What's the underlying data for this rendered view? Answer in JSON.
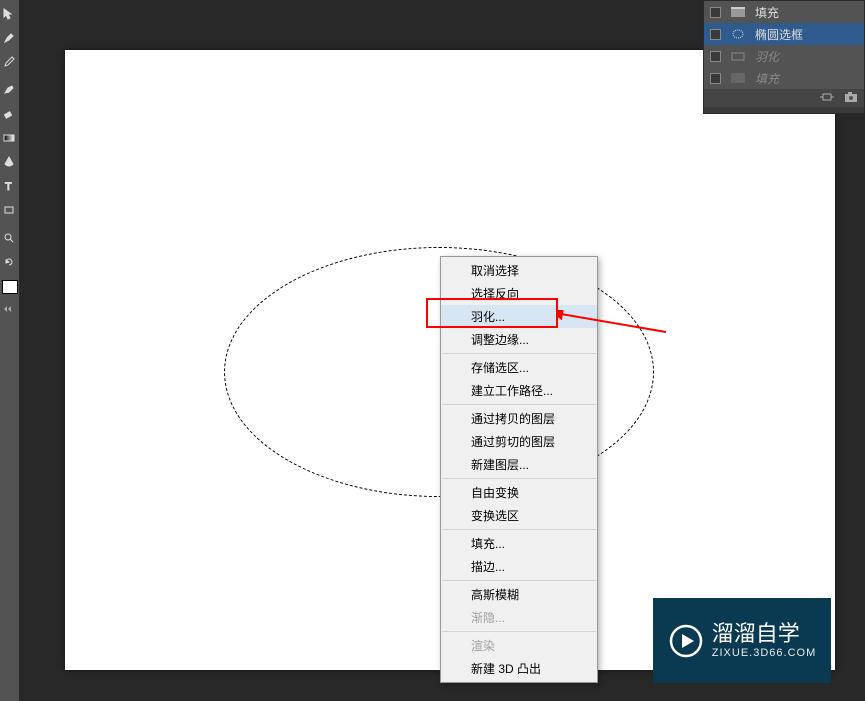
{
  "contextMenu": {
    "deselect": "取消选择",
    "selectInverse": "选择反向",
    "feather": "羽化...",
    "refineEdge": "调整边缘...",
    "saveSelection": "存储选区...",
    "makeWorkPath": "建立工作路径...",
    "layerViaCopy": "通过拷贝的图层",
    "layerViaCut": "通过剪切的图层",
    "newLayer": "新建图层...",
    "freeTransform": "自由变换",
    "transformSelection": "变换选区",
    "fill": "填充...",
    "stroke": "描边...",
    "gaussianBlur": "高斯模糊",
    "fade": "渐隐...",
    "render": "渲染",
    "new3dExtrusion": "新建 3D 凸出"
  },
  "historyPanel": {
    "fill": "填充",
    "ellipseSelection": "椭圆选框",
    "feather": "羽化",
    "fill2": "填充"
  },
  "watermark": {
    "main": "溜溜自学",
    "sub": "ZIXUE.3D66.COM"
  }
}
